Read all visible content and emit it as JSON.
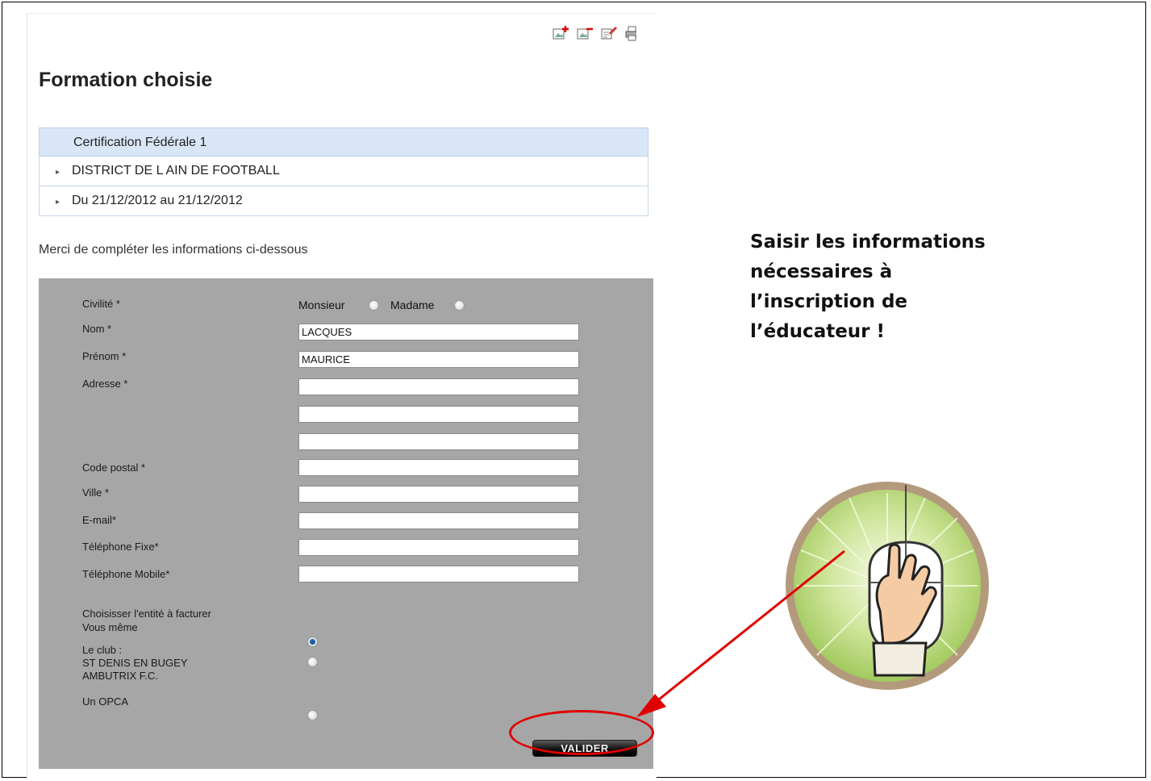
{
  "page": {
    "title": "Formation choisie",
    "toolbar_icons": [
      "add-image-icon",
      "remove-image-icon",
      "edit-icon",
      "print-icon"
    ]
  },
  "formation": {
    "name": "Certification Fédérale 1",
    "organizer": "DISTRICT DE L AIN DE FOOTBALL",
    "dates": "Du 21/12/2012 au 21/12/2012"
  },
  "form": {
    "instructions": "Merci de compléter les informations ci-dessous",
    "civility": {
      "label": "Civilité *",
      "options": [
        "Monsieur",
        "Madame"
      ],
      "selected": null
    },
    "fields": {
      "nom": {
        "label": "Nom *",
        "value": "LACQUES"
      },
      "prenom": {
        "label": "Prénom *",
        "value": "MAURICE"
      },
      "adresse": {
        "label": "Adresse *",
        "value1": "",
        "value2": "",
        "value3": ""
      },
      "code_postal": {
        "label": "Code postal *",
        "value": ""
      },
      "ville": {
        "label": "Ville *",
        "value": ""
      },
      "email": {
        "label": "E-mail*",
        "value": ""
      },
      "tel_fixe": {
        "label": "Téléphone Fixe*",
        "value": ""
      },
      "tel_mobile": {
        "label": "Téléphone Mobile*",
        "value": ""
      }
    },
    "billing": {
      "heading": "Choisisser l'entité à facturer",
      "option_self": "Vous même",
      "option_club_line1": "Le club :",
      "option_club_line2": "ST DENIS EN BUGEY",
      "option_club_line3": "AMBUTRIX F.C.",
      "option_opca": "Un OPCA",
      "selected": "Vous même"
    },
    "submit_label": "VALIDER"
  },
  "annotation": {
    "callout_lines": [
      "Saisir les informations",
      "nécessaires à",
      "l’inscription de",
      "l’éducateur !"
    ],
    "highlight_color": "#e00000",
    "badge_icon": "mouse-click-icon"
  }
}
